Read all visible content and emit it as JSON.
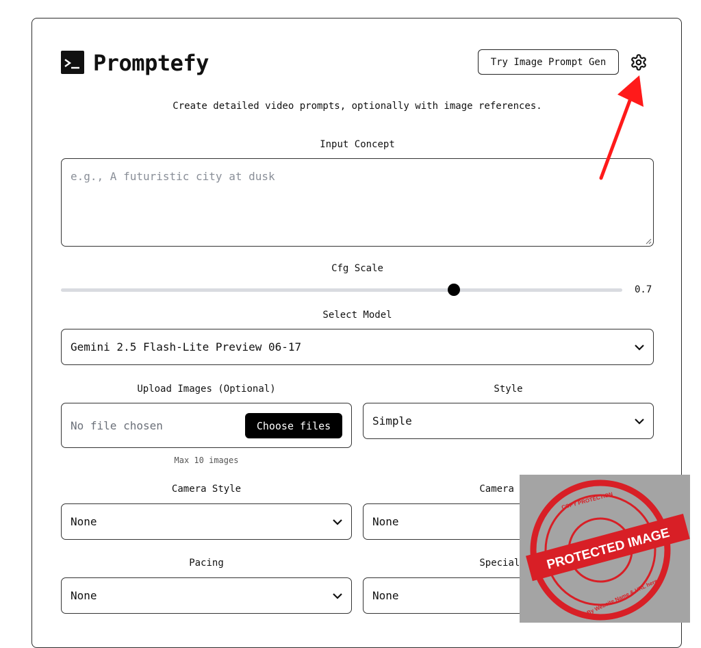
{
  "header": {
    "brand": "Promptefy",
    "try_button": "Try Image Prompt Gen",
    "subtitle": "Create detailed video prompts, optionally with image references."
  },
  "concept": {
    "label": "Input Concept",
    "placeholder": "e.g., A futuristic city at dusk"
  },
  "cfg": {
    "label": "Cfg Scale",
    "value": "0.7",
    "fraction": 0.7
  },
  "model": {
    "label": "Select Model",
    "selected": "Gemini 2.5 Flash-Lite Preview 06-17"
  },
  "upload": {
    "label": "Upload Images (Optional)",
    "status": "No file chosen",
    "button": "Choose files",
    "hint": "Max 10 images"
  },
  "style": {
    "label": "Style",
    "selected": "Simple"
  },
  "camera_style": {
    "label": "Camera Style",
    "selected": "None"
  },
  "camera_direction": {
    "label": "Camera Dir",
    "selected": "None"
  },
  "pacing": {
    "label": "Pacing",
    "selected": "None"
  },
  "special_effects": {
    "label": "Special Ef",
    "selected": "None"
  },
  "stamp": {
    "top_text": "COPY PROTECTION",
    "main_text": "PROTECTED IMAGE",
    "bottom_text": "By Website Name & URL here"
  },
  "colors": {
    "accent": "#000000",
    "arrow": "#ff1a1a",
    "stamp": "#d81f26",
    "overlay_bg": "#a4a4a4"
  },
  "icons": [
    "terminal-icon",
    "gear-icon",
    "chevron-down-icon",
    "resize-grip-icon"
  ]
}
